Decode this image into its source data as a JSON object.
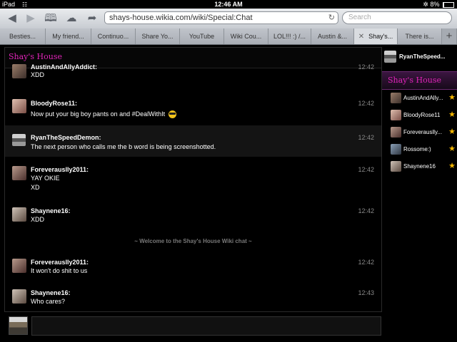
{
  "status_bar": {
    "device": "iPad",
    "clock": "12:46 AM",
    "battery": "8%"
  },
  "toolbar": {
    "url": "shays-house.wikia.com/wiki/Special:Chat",
    "search_placeholder": "Search"
  },
  "tabs": [
    {
      "label": "Besties..."
    },
    {
      "label": "My friend..."
    },
    {
      "label": "Continuo..."
    },
    {
      "label": "Share Yo..."
    },
    {
      "label": "YouTube"
    },
    {
      "label": "Wiki Cou..."
    },
    {
      "label": "LOL!!! :) /..."
    },
    {
      "label": "Austin &..."
    },
    {
      "label": "Shay's...",
      "active": true
    },
    {
      "label": "There is..."
    }
  ],
  "chat": {
    "room_title": "Shay's House",
    "messages": [
      {
        "user": "AustinAndAllyAddict:",
        "lines": [
          "XDD"
        ],
        "time": "12:42"
      },
      {
        "user": "BloodyRose11:",
        "lines": [
          "Now put your big boy pants on and #DealWithIt"
        ],
        "time": "12:42"
      },
      {
        "user": "RyanTheSpeedDemon:",
        "lines": [
          "The next person who calls me the b word is being screenshotted."
        ],
        "time": "12:42"
      },
      {
        "user": "Foreverauslly2011:",
        "lines": [
          "YAY OKIE",
          "XD"
        ],
        "time": "12:42"
      },
      {
        "user": "Shaynene16:",
        "lines": [
          "XDD"
        ],
        "time": "12:42"
      },
      {
        "user": "Foreverauslly2011:",
        "lines": [
          "It won't do shit to us"
        ],
        "time": "12:42"
      },
      {
        "user": "Shaynene16:",
        "lines": [
          "Who cares?"
        ],
        "time": "12:43"
      }
    ],
    "welcome": "~ Welcome to the Shay's House Wiki chat ~"
  },
  "sidebar": {
    "self_user": "RyanTheSpeed...",
    "room_title": "Shay's House",
    "users": [
      {
        "name": "AustinAndAlly..."
      },
      {
        "name": "BloodyRose11"
      },
      {
        "name": "Foreverauslly..."
      },
      {
        "name": "Rossome:)"
      },
      {
        "name": "Shaynene16"
      }
    ]
  },
  "colors": {
    "accent": "#e024b8",
    "star": "#f5b700"
  }
}
